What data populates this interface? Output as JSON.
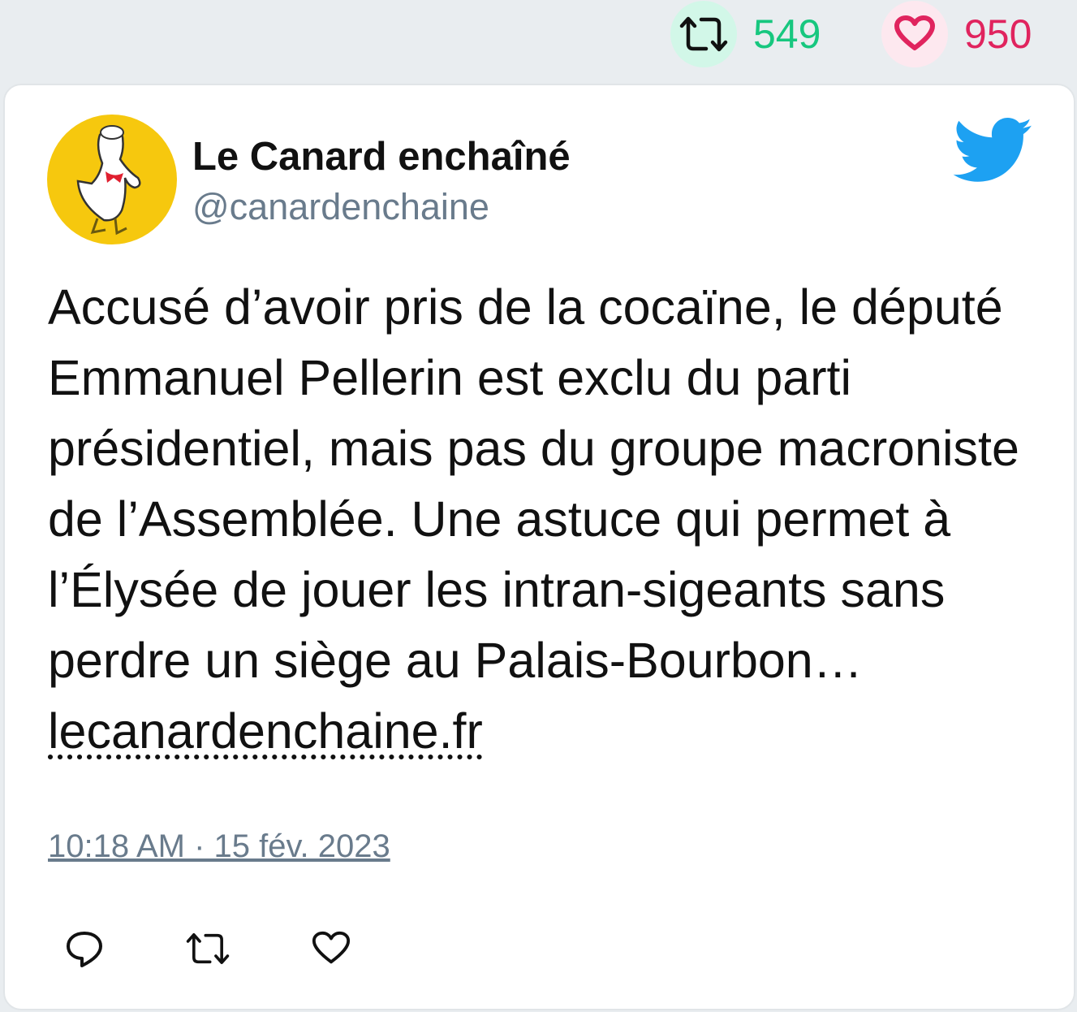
{
  "stats": {
    "retweets": "549",
    "likes": "950",
    "retweet_color": "#17bf63",
    "like_color": "#e0245e"
  },
  "tweet": {
    "author_name": "Le Canard enchaîné",
    "author_handle": "@canardenchaine",
    "text": "Accusé d’avoir pris de la cocaïne, le député Emmanuel Pellerin est exclu du parti présidentiel, mais pas du groupe macroniste de l’Assemblée. Une astuce qui permet à l’Élysée de jouer les intran-sigeants sans perdre un siège au Palais-Bourbon… ",
    "link_text": "lecanardenchaine.fr",
    "timestamp": "10:18 AM · 15 fév. 2023"
  },
  "icons": {
    "brand": "twitter-bird-icon",
    "actions": [
      "reply-icon",
      "retweet-icon",
      "like-icon"
    ]
  }
}
